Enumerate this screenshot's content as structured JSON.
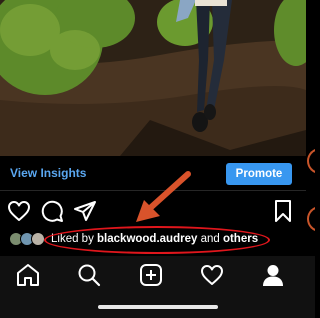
{
  "post": {
    "view_insights_label": "View Insights",
    "promote_label": "Promote",
    "likes": {
      "prefix": "Liked by ",
      "user": "blackwood.audrey",
      "middle": " and ",
      "others": "others"
    }
  },
  "icons": {
    "like": "heart-outline-icon",
    "comment": "comment-bubble-icon",
    "share": "paper-plane-icon",
    "save": "bookmark-icon"
  },
  "tabbar": {
    "items": [
      {
        "name": "home",
        "icon": "home-icon"
      },
      {
        "name": "search",
        "icon": "search-icon"
      },
      {
        "name": "new-post",
        "icon": "plus-square-icon"
      },
      {
        "name": "activity",
        "icon": "heart-icon"
      },
      {
        "name": "profile",
        "icon": "profile-icon"
      }
    ]
  },
  "colors": {
    "accent_blue": "#3897f0",
    "link_blue": "#5aa7f0",
    "annotation_red": "#e0161c",
    "annotation_arrow": "#d9532b",
    "background": "#000000"
  }
}
